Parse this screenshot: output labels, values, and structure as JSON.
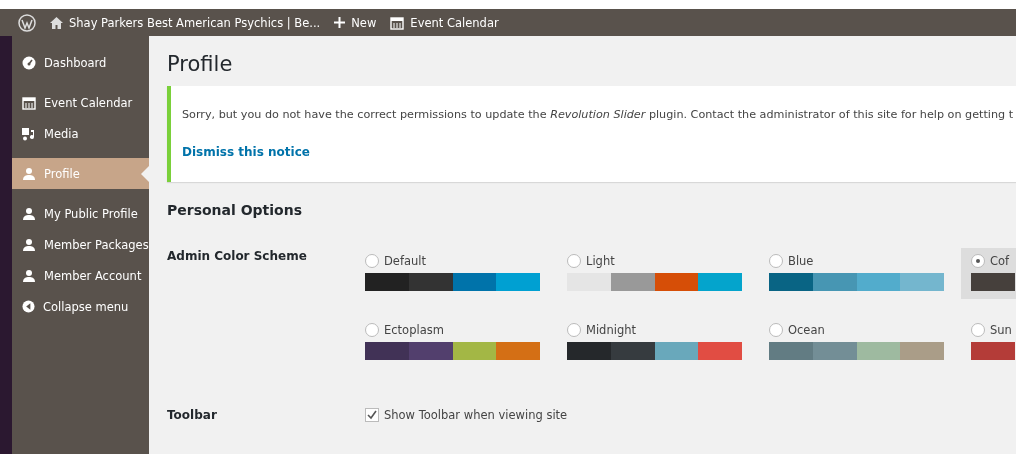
{
  "admin_bar": {
    "site_title": "Shay Parkers Best American Psychics | Be...",
    "new_label": "New",
    "calendar_label": "Event Calendar"
  },
  "sidebar": {
    "groups": [
      [
        {
          "label": "Dashboard",
          "kind": "link",
          "selected": false
        }
      ],
      [
        {
          "label": "Event Calendar",
          "kind": "link",
          "selected": false
        },
        {
          "label": "Media",
          "kind": "link",
          "selected": false
        }
      ],
      [
        {
          "label": "Profile",
          "kind": "link",
          "selected": true
        }
      ],
      [
        {
          "label": "My Public Profile",
          "kind": "link",
          "selected": false
        },
        {
          "label": "Member Packages",
          "kind": "link",
          "selected": false
        },
        {
          "label": "Member Account",
          "kind": "link",
          "selected": false
        },
        {
          "label": "Collapse menu",
          "kind": "collapse",
          "selected": false
        }
      ]
    ]
  },
  "page_title": "Profile",
  "notice": {
    "message": "Sorry, but you do not have the correct permissions to update the *Revolution Slider* plugin. Contact the administrator of this site for help on getting t",
    "dismiss": "Dismiss this notice"
  },
  "section_title": "Personal Options",
  "color_scheme": {
    "label": "Admin Color Scheme",
    "schemes": [
      {
        "name": "Default",
        "selected": false,
        "swatches": [
          {
            "color": "#222222"
          },
          {
            "color": "#333333"
          },
          {
            "color": "#0073aa"
          },
          {
            "color": "#00a0d2"
          }
        ]
      },
      {
        "name": "Light",
        "selected": false,
        "swatches": [
          {
            "color": "#e5e5e5"
          },
          {
            "color": "#999999"
          },
          {
            "color": "#d64e07"
          },
          {
            "color": "#04a4cc"
          }
        ]
      },
      {
        "name": "Blue",
        "selected": false,
        "swatches": [
          {
            "color": "#096484"
          },
          {
            "color": "#4796b3"
          },
          {
            "color": "#52accc"
          },
          {
            "color": "#74b6ce"
          }
        ]
      },
      {
        "name": "Cof",
        "selected": true,
        "swatches": [
          {
            "color": "#46403c"
          }
        ]
      },
      {
        "name": "Ectoplasm",
        "selected": false,
        "swatches": [
          {
            "color": "#413256"
          },
          {
            "color": "#523f6d"
          },
          {
            "color": "#a3b745"
          },
          {
            "color": "#d46f15"
          }
        ]
      },
      {
        "name": "Midnight",
        "selected": false,
        "swatches": [
          {
            "color": "#25282b"
          },
          {
            "color": "#363b3f"
          },
          {
            "color": "#69a8bb"
          },
          {
            "color": "#e14d43"
          }
        ]
      },
      {
        "name": "Ocean",
        "selected": false,
        "swatches": [
          {
            "color": "#627c83"
          },
          {
            "color": "#738e96"
          },
          {
            "color": "#9ebaa0"
          },
          {
            "color": "#aa9d88"
          }
        ]
      },
      {
        "name": "Sun",
        "selected": false,
        "swatches": [
          {
            "color": "#b43c38"
          }
        ]
      }
    ]
  },
  "toolbar": {
    "label": "Toolbar",
    "option": "Show Toolbar when viewing site",
    "checked": true
  }
}
